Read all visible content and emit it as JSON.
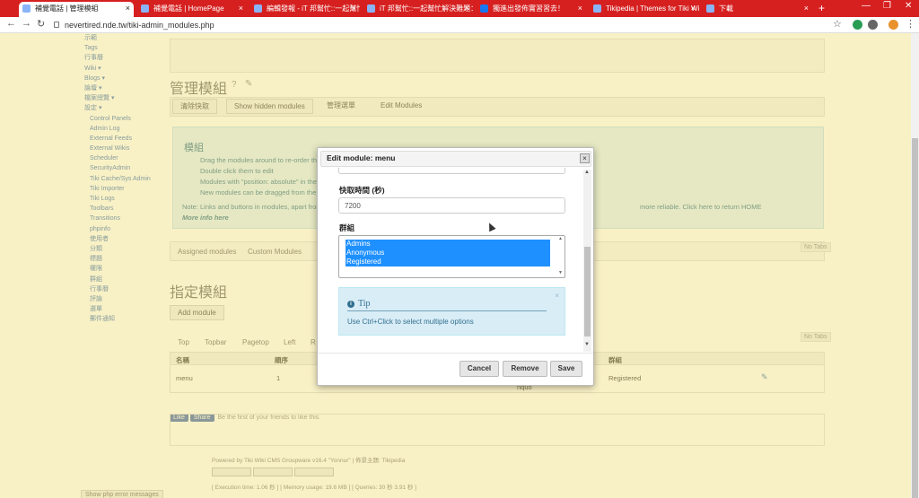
{
  "browser": {
    "tabs": [
      {
        "title": "補覺電話 | 管理模組",
        "active": true
      },
      {
        "title": "補覺電話 | HomePage"
      },
      {
        "title": "編輯發報 - iT 邦幫忙::一起幫忙解"
      },
      {
        "title": "iT 邦幫忙::一起幫忙解決難題：拯"
      },
      {
        "title": "獨進出發佈實習習去！"
      },
      {
        "title": "Tikipedia | Themes for Tiki Wi"
      },
      {
        "title": "下載"
      }
    ],
    "url": "nevertired.nde.tw/tiki-admin_modules.php"
  },
  "sidebar": {
    "items": [
      "示範",
      "Tags",
      "行事曆",
      "Wiki ▾",
      "Blogs ▾",
      "論壇 ▾",
      "檔案總覽 ▾",
      "設定 ▾",
      "Control Panels",
      "Admin Log",
      "External Feeds",
      "External Wikis",
      "Scheduler",
      "SecurityAdmin",
      "Tiki Cache/Sys Admin",
      "Tiki Importer",
      "Tiki Logs",
      "Toolbars",
      "Transitions",
      "phpinfo",
      "使用者",
      "分類",
      "標題",
      "權限",
      "群組",
      "行事曆",
      "評論",
      "選單",
      "郵件通知"
    ]
  },
  "main": {
    "heading1": "管理模組",
    "toolbar": [
      "清除快取",
      "Show hidden modules",
      "管理選單",
      "Edit Modules"
    ],
    "info_title": "模組",
    "info_lines": [
      "Drag the modules around to re-order then",
      "Double click them to edit",
      "Modules with \"position: absolute\" in their",
      "New modules can be dragged from the \"A"
    ],
    "note": "Note: Links and buttons in modules, apart from ...",
    "note_tail": "more reliable. Click here to return HOME",
    "more_info": "More info here",
    "tabs_top": [
      "Assigned modules",
      "Custom Modules"
    ],
    "heading2": "指定模組",
    "add_module": "Add module",
    "pos_tabs": [
      "Top",
      "Topbar",
      "Pagetop",
      "Left",
      "R"
    ],
    "no_tabs": "No Tabs",
    "table_headers": [
      "名稱",
      "順序",
      "群組"
    ],
    "table_row": [
      "menu",
      "1",
      "Registered"
    ],
    "table_row_extra": "nquo",
    "like_label": "Like",
    "share_label": "Share",
    "like_text": "Be the first of your friends to like this.",
    "footer1": "Powered by Tiki Wiki CMS Groupware v16.4 \"Yonnur\" | 佈景主題: Tikipedia",
    "footer2": "[ Execution time: 1.06 秒 ] [ Memory usage: 19.6 MB ] [ Queries: 30 秒 3.91 秒 ]",
    "smart_toggle": "Show php error messages"
  },
  "modal": {
    "title": "Edit module: menu",
    "close": "×",
    "cache_label": "快取時間 (秒)",
    "cache_value": "7200",
    "groups_label": "群組",
    "groups": [
      "Admins",
      "Anonymous",
      "Registered"
    ],
    "tip_title": "Tip",
    "tip_text": "Use Ctrl+Click to select multiple options",
    "buttons": {
      "cancel": "Cancel",
      "remove": "Remove",
      "save": "Save"
    }
  }
}
